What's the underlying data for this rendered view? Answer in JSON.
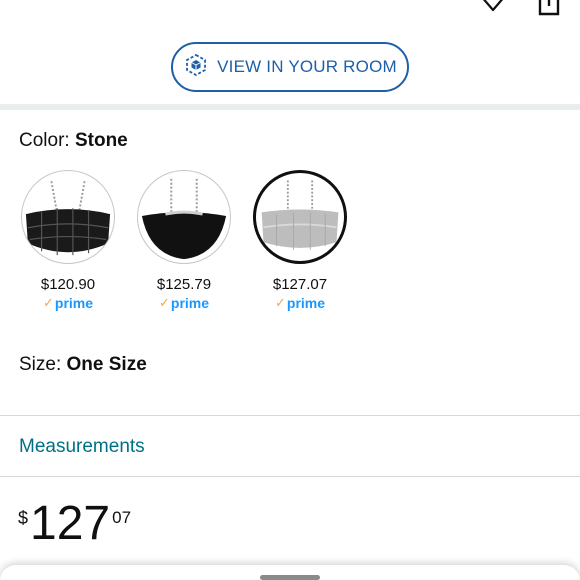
{
  "header": {
    "icons": [
      "heart-icon",
      "share-icon"
    ]
  },
  "view_in_room": {
    "label": "VIEW IN YOUR ROOM",
    "icon": "cube-ar-icon"
  },
  "color": {
    "label": "Color: ",
    "value": "Stone"
  },
  "swatches": [
    {
      "price": "$120.90",
      "badge": "prime",
      "variant": "black-quilted",
      "selected": false
    },
    {
      "price": "$125.79",
      "badge": "prime",
      "variant": "black-smooth",
      "selected": false
    },
    {
      "price": "$127.07",
      "badge": "prime",
      "variant": "stone-silver",
      "selected": true
    }
  ],
  "size": {
    "label": "Size: ",
    "value": "One Size"
  },
  "measurements": {
    "label": "Measurements"
  },
  "price": {
    "symbol": "$",
    "whole": "127",
    "fraction": "07"
  },
  "colors": {
    "link": "#007185",
    "button_blue": "#1d5fa8",
    "prime_blue": "#1a98ff",
    "prime_check": "#f3a847",
    "text": "#0f1111"
  }
}
